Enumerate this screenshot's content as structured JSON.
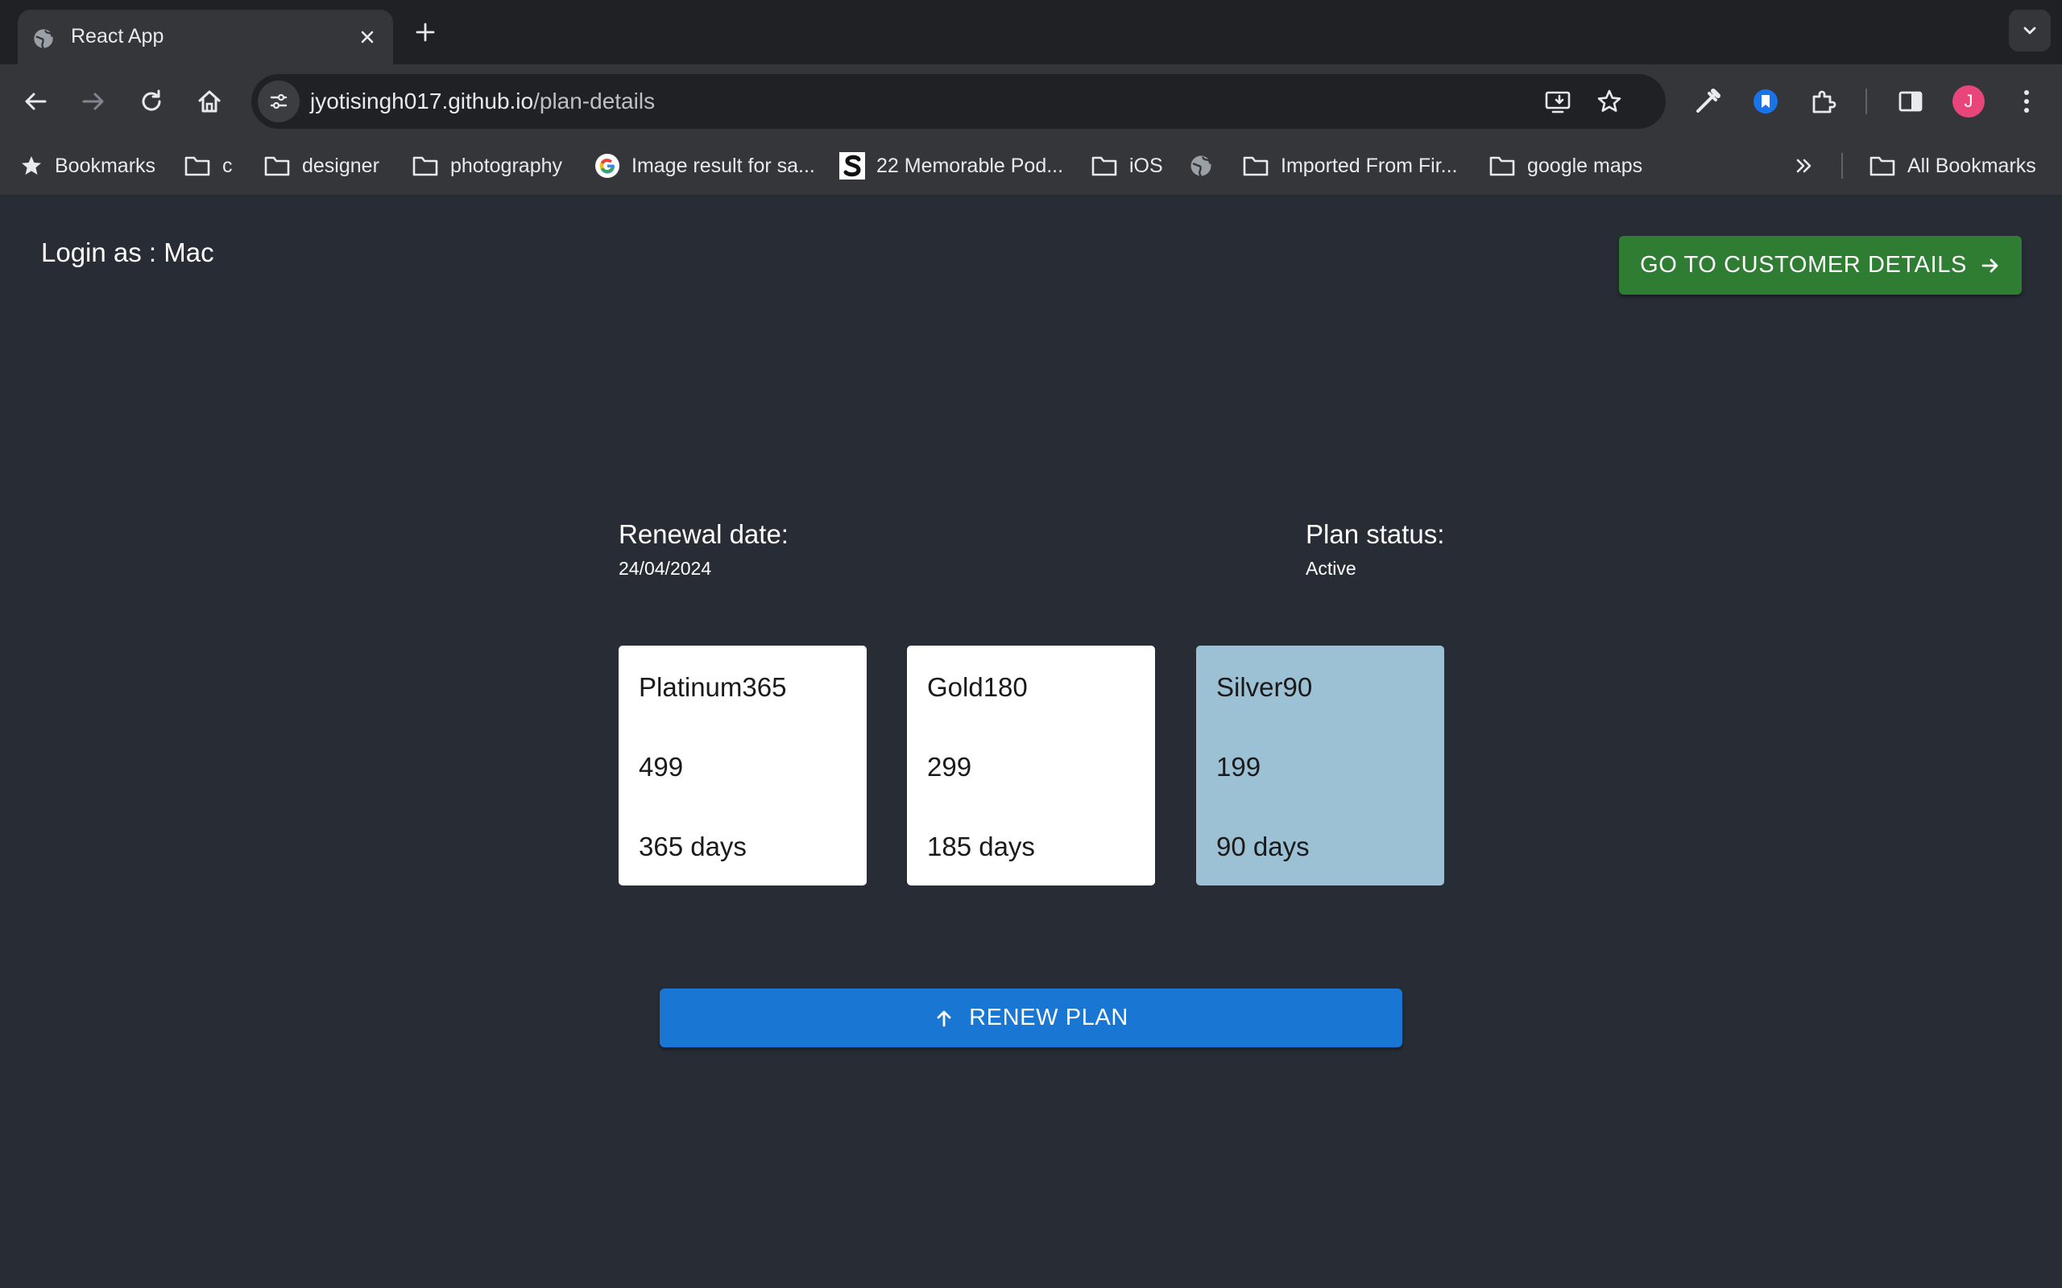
{
  "browser": {
    "tab_title": "React App",
    "url_host": "jyotisingh017.github.io",
    "url_path": "/plan-details",
    "avatar_initial": "J",
    "bookmarks": [
      {
        "label": "Bookmarks",
        "icon": "star-icon"
      },
      {
        "label": "c",
        "icon": "folder-icon"
      },
      {
        "label": "designer",
        "icon": "folder-icon"
      },
      {
        "label": "photography",
        "icon": "folder-icon"
      },
      {
        "label": "Image result for sa...",
        "icon": "google-icon"
      },
      {
        "label": "22 Memorable Pod...",
        "icon": "site-s-icon"
      },
      {
        "label": "iOS",
        "icon": "folder-icon"
      },
      {
        "label": "",
        "icon": "globe-icon"
      },
      {
        "label": "Imported From Fir...",
        "icon": "folder-icon"
      },
      {
        "label": "google maps",
        "icon": "folder-icon"
      }
    ],
    "all_bookmarks": "All Bookmarks"
  },
  "page": {
    "login_text": "Login as : Mac",
    "customer_button": "GO TO CUSTOMER DETAILS",
    "renewal_label": "Renewal date:",
    "renewal_value": "24/04/2024",
    "status_label": "Plan status:",
    "status_value": "Active",
    "plans": [
      {
        "name": "Platinum365",
        "price": "499",
        "duration": "365 days",
        "selected": false
      },
      {
        "name": "Gold180",
        "price": "299",
        "duration": "185 days",
        "selected": false
      },
      {
        "name": "Silver90",
        "price": "199",
        "duration": "90 days",
        "selected": true
      }
    ],
    "renew_button": "RENEW PLAN"
  },
  "colors": {
    "page_bg": "#282c34",
    "customer_button": "#2e7d32",
    "renew_button": "#1976d2",
    "selected_card": "#9cc0d4"
  }
}
